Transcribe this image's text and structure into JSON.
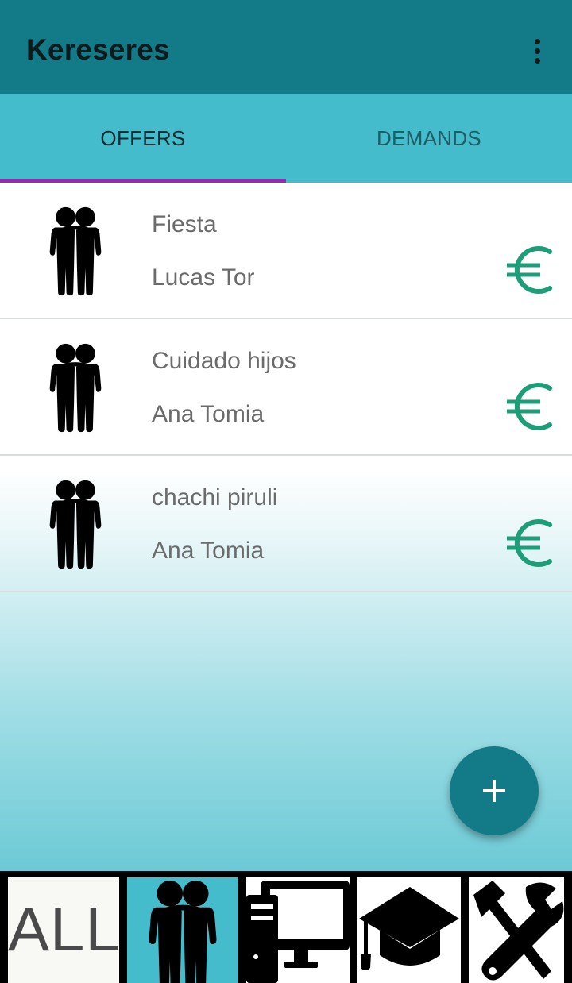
{
  "app": {
    "title": "Kereseres"
  },
  "tabs": [
    {
      "label": "OFFERS",
      "active": true
    },
    {
      "label": "DEMANDS",
      "active": false
    }
  ],
  "items": [
    {
      "title": "Fiesta",
      "name": "Lucas Tor",
      "icon": "people-icon",
      "price_icon": "euro-icon"
    },
    {
      "title": "Cuidado hijos",
      "name": "Ana Tomia",
      "icon": "people-icon",
      "price_icon": "euro-icon"
    },
    {
      "title": "chachi piruli",
      "name": "Ana Tomia",
      "icon": "people-icon",
      "price_icon": "euro-icon"
    }
  ],
  "fab": {
    "icon": "plus-icon"
  },
  "categories": [
    {
      "label": "ALL",
      "icon": "all-text",
      "selected": false
    },
    {
      "label": "",
      "icon": "people-icon",
      "selected": true
    },
    {
      "label": "",
      "icon": "computer-icon",
      "selected": false
    },
    {
      "label": "",
      "icon": "graduation-cap-icon",
      "selected": false
    },
    {
      "label": "",
      "icon": "tools-icon",
      "selected": false
    }
  ],
  "colors": {
    "appbar": "#137b87",
    "tabs": "#44bccb",
    "indicator": "#9c27b0",
    "euro": "#1e9e78",
    "fab": "#137b87"
  }
}
